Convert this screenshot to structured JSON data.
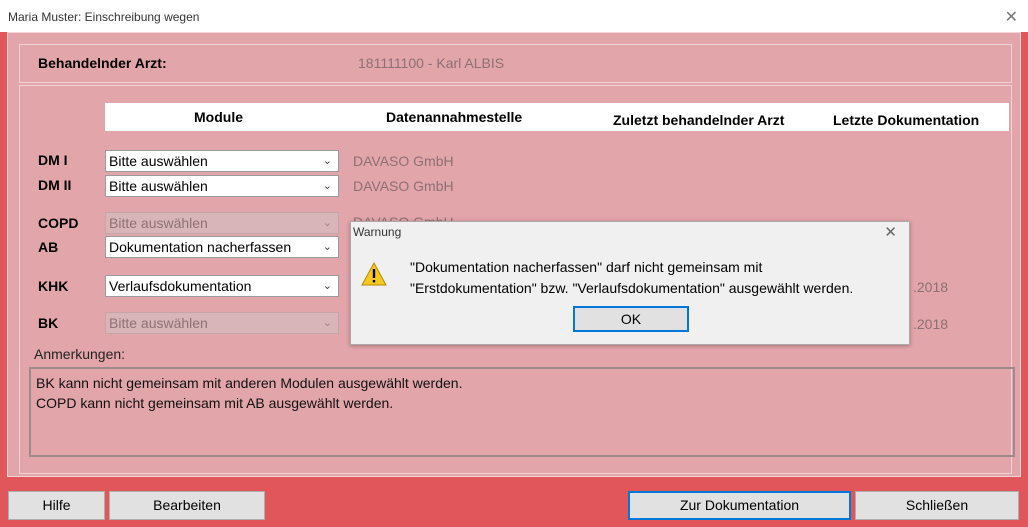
{
  "window": {
    "title": "Maria Muster: Einschreibung wegen",
    "close_glyph": "✕"
  },
  "header": {
    "label": "Behandelnder Arzt:",
    "value": "181111100 - Karl ALBIS"
  },
  "columns": {
    "module": "Module",
    "annahme": "Datenannahmestelle",
    "zuletzt": "Zuletzt behandelnder Arzt",
    "letzte": "Letzte Dokumentation"
  },
  "rows": [
    {
      "label": "DM I",
      "select": "Bitte auswählen",
      "annahme": "DAVASO GmbH"
    },
    {
      "label": "DM II",
      "select": "Bitte auswählen",
      "annahme": "DAVASO GmbH"
    },
    {
      "label": "COPD",
      "select": "Bitte auswählen",
      "annahme": "DAVASO GmbH"
    },
    {
      "label": "AB",
      "select": "Dokumentation nacherfassen"
    },
    {
      "label": "KHK",
      "select": "Verlaufsdokumentation",
      "year": ".2018"
    },
    {
      "label": "BK",
      "select": "Bitte auswählen",
      "year": ".2018"
    }
  ],
  "chevron": "⌄",
  "notes": {
    "label": "Anmerkungen:",
    "lines": [
      "BK kann nicht gemeinsam mit anderen Modulen ausgewählt werden.",
      "COPD kann nicht gemeinsam mit AB ausgewählt werden."
    ]
  },
  "buttons": {
    "hilfe": "Hilfe",
    "bearbeiten": "Bearbeiten",
    "zur_doku": "Zur Dokumentation",
    "schliessen": "Schließen"
  },
  "dialog": {
    "title": "Warnung",
    "close_glyph": "✕",
    "icon": "warning-icon",
    "line1": "\"Dokumentation nacherfassen\" darf nicht gemeinsam mit",
    "line2": "\"Erstdokumentation\" bzw. \"Verlaufsdokumentation\" ausgewählt werden.",
    "ok": "OK"
  },
  "colors": {
    "frame": "#e0565b",
    "panel": "#e2a5aa",
    "focus": "#0078d7"
  }
}
